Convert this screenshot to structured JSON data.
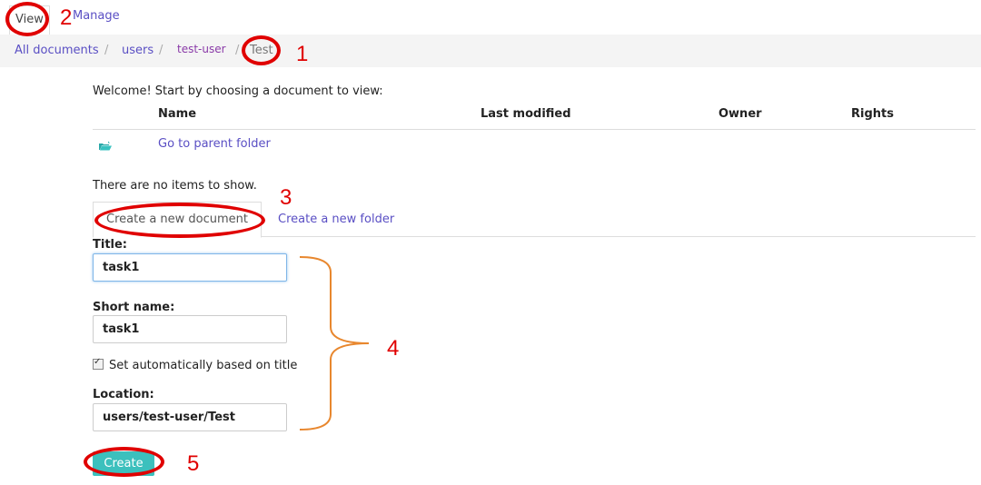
{
  "top_tabs": {
    "view": "View",
    "manage": "Manage"
  },
  "breadcrumb": [
    "All documents",
    "users",
    "test-user",
    "Test"
  ],
  "welcome": "Welcome! Start by choosing a document to view:",
  "table": {
    "columns": [
      "Name",
      "Last modified",
      "Owner",
      "Rights"
    ],
    "parent_folder": "Go to parent folder"
  },
  "no_items": "There are no items to show.",
  "form_tabs": {
    "new_document": "Create a new document",
    "new_folder": "Create a new folder"
  },
  "form": {
    "title_label": "Title:",
    "title_value": "task1",
    "short_name_label": "Short name:",
    "short_name_value": "task1",
    "auto_checkbox": "Set automatically based on title",
    "location_label": "Location:",
    "location_value": "users/test-user/Test",
    "create_button": "Create"
  },
  "annotations": [
    "1",
    "2",
    "3",
    "4",
    "5"
  ],
  "colors": {
    "link": "#5a4fc4",
    "button": "#3cc0bd",
    "annotation": "#e00000",
    "bracket": "#e8872e"
  }
}
